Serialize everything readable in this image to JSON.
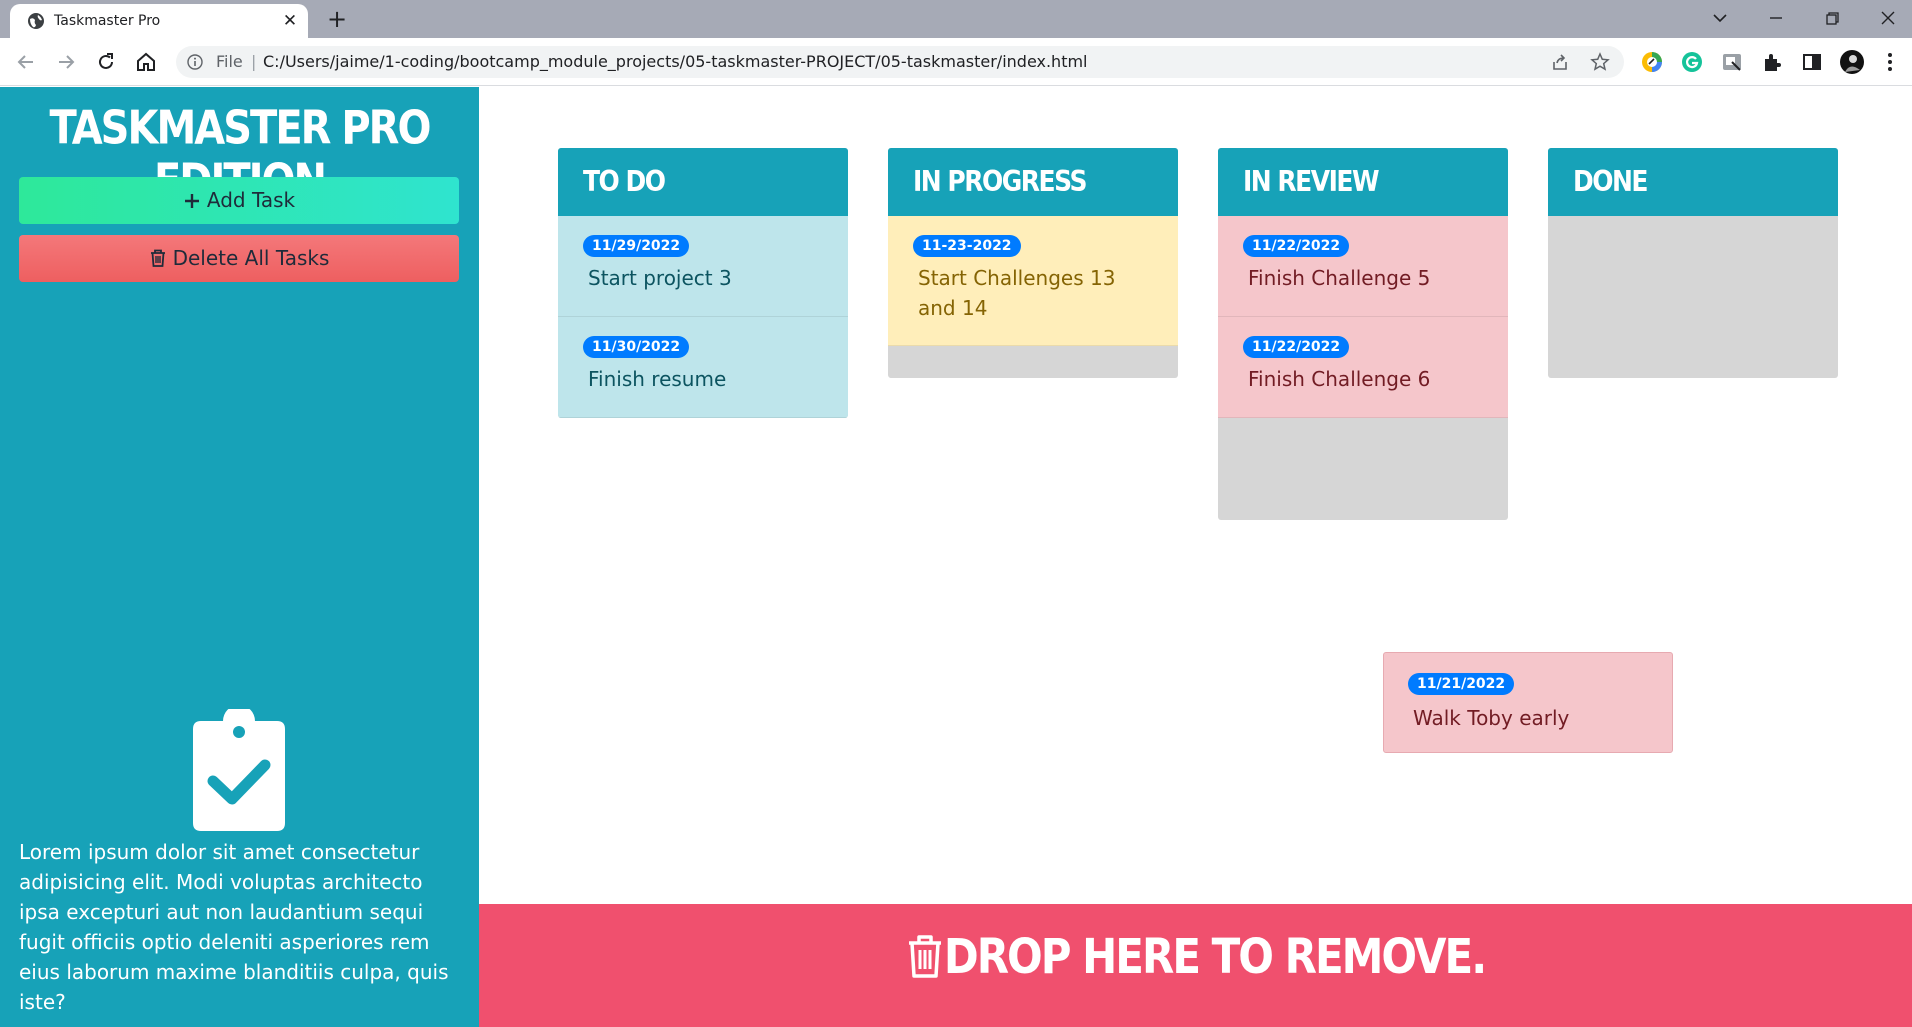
{
  "browser": {
    "tab_title": "Taskmaster Pro",
    "omnibox": {
      "scheme_label": "File",
      "separator": "|",
      "url": "C:/Users/jaime/1-coding/bootcamp_module_projects/05-taskmaster-PROJECT/05-taskmaster/index.html"
    }
  },
  "sidebar": {
    "title": "TASKMASTER PRO EDITION",
    "add_button": "Add Task",
    "delete_button": "Delete All Tasks",
    "description": "Lorem ipsum dolor sit amet consectetur adipisicing elit. Modi voluptas architecto ipsa excepturi aut non laudantium sequi fugit officiis optio deleniti asperiores rem eius laborum maxime blanditiis culpa, quis iste?"
  },
  "columns": [
    {
      "title": "TO DO",
      "tasks": [
        {
          "date": "11/29/2022",
          "text": "Start project 3"
        },
        {
          "date": "11/30/2022",
          "text": "Finish resume"
        }
      ]
    },
    {
      "title": "IN PROGRESS",
      "tasks": [
        {
          "date": "11-23-2022",
          "text": "Start Challenges 13 and 14"
        }
      ]
    },
    {
      "title": "IN REVIEW",
      "tasks": [
        {
          "date": "11/22/2022",
          "text": "Finish Challenge 5"
        },
        {
          "date": "11/22/2022",
          "text": "Finish Challenge 6"
        }
      ]
    },
    {
      "title": "DONE",
      "tasks": []
    }
  ],
  "dragging_task": {
    "date": "11/21/2022",
    "text": "Walk Toby early"
  },
  "drop_zone": {
    "label": "DROP HERE TO REMOVE."
  },
  "colors": {
    "teal": "#17a2b8",
    "danger_zone": "#f0506e",
    "badge": "#007bff",
    "info_card": "#bee5eb",
    "warning_card": "#ffeeba",
    "danger_card": "#f5c6cb"
  }
}
